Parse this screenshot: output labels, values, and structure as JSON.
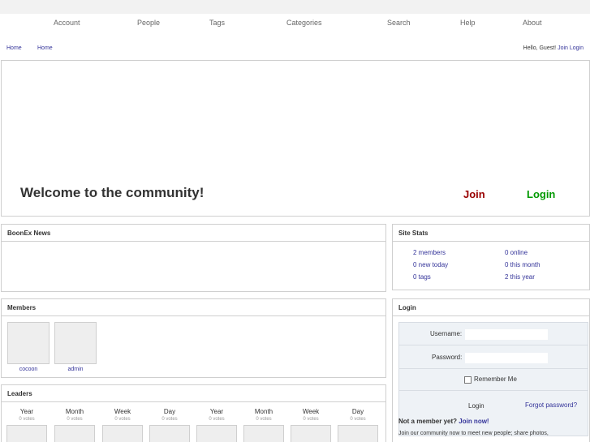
{
  "menu": {
    "items": [
      "Account",
      "People",
      "Tags",
      "Categories",
      "Search",
      "Help",
      "About"
    ]
  },
  "breadcrumb": {
    "home_link": "Home",
    "current": "Home"
  },
  "guest": {
    "greeting": "Hello, Guest!",
    "join": "Join",
    "login": "Login"
  },
  "hero": {
    "title": "Welcome to the community!",
    "join_label": "Join",
    "login_label": "Login"
  },
  "news": {
    "title": "BoonEx News"
  },
  "stats": {
    "title": "Site Stats",
    "items": [
      "2 members",
      "0 online",
      "0 new today",
      "0 this month",
      "0 tags",
      "2 this year"
    ]
  },
  "members": {
    "title": "Members",
    "items": [
      "cocoon",
      "admin"
    ]
  },
  "leaders": {
    "title": "Leaders",
    "columns": [
      "Year",
      "Month",
      "Week",
      "Day",
      "Year",
      "Month",
      "Week",
      "Day"
    ],
    "votes": "0 votes"
  },
  "login": {
    "title": "Login",
    "username_label": "Username:",
    "password_label": "Password:",
    "username_value": "",
    "password_value": "",
    "remember_label": "Remember Me",
    "submit_label": "Login",
    "forgot_label": "Forgot password?",
    "not_member": "Not a member yet?",
    "join_now": "Join now!",
    "join_text": "Join our community now to meet new people; share photos,"
  },
  "colors": {
    "link": "#333399",
    "join_red": "#990000",
    "login_green": "#009900",
    "border": "#cfcfcf"
  }
}
